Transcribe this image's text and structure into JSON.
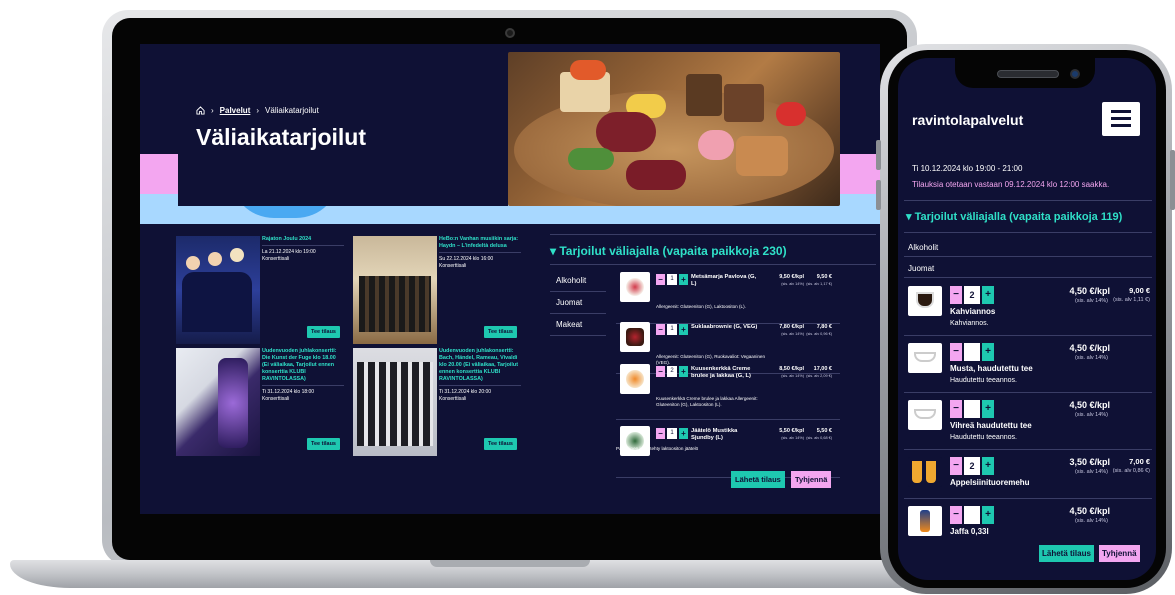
{
  "laptop": {
    "breadcrumb": {
      "home_icon": "home-icon",
      "sep": "›",
      "link": "Palvelut",
      "current": "Väliaikatarjoilut"
    },
    "page_title": "Väliaikatarjoilut",
    "events": [
      {
        "title": "Rajaton Joulu 2024",
        "date": "La 21.12.2024 klo 19:00",
        "venue": "Konserttisali",
        "button": "Tee tilaus"
      },
      {
        "title": "HeBo:n Vanhan musiikin sarja: Haydn – L'infedeltà delusa",
        "date": "Su 22.12.2024 klo 16:00",
        "venue": "Konserttisali",
        "button": "Tee tilaus"
      },
      {
        "title": "Uudenvuoden juhlakonsertti: Die Kunst der Fuge klo 18.00 (Ei väliaikaa, Tarjoilut ennen konserttia KLUBI RAVINTOLASSA)",
        "date": "Ti 31.12.2024 klo 18:00",
        "venue": "Konserttisali",
        "button": "Tee tilaus"
      },
      {
        "title": "Uudenvuoden juhlakonsertti: Bach, Händel, Rameau, Vivaldi klo 20.00 (Ei väliaikaa, Tarjoilut ennen konserttia KLUBI RAVINTOLASSA)",
        "date": "Ti 31.12.2024 klo 20:00",
        "venue": "Konserttisali",
        "button": "Tee tilaus"
      }
    ],
    "offer_title": "Tarjoilut väliajalla (vapaita paikkoja 230)",
    "categories": [
      "Alkoholit",
      "Juomat",
      "Makeat"
    ],
    "products": [
      {
        "qty": "1",
        "name": "Metsämarja Pavlova (G, L)",
        "price": "9,50 €/kpl",
        "vat": "(sis. alv 14%)",
        "total": "9,50 €",
        "total_vat": "(sis. alv 1,17 €)",
        "desc": "Allergeenit: Gluteeniton (G), Laktoositon (L)."
      },
      {
        "qty": "1",
        "name": "Suklaabrownie (G, VEG)",
        "price": "7,80 €/kpl",
        "vat": "(sis. alv 14%)",
        "total": "7,80 €",
        "total_vat": "(sis. alv 0,96 €)",
        "desc": "Allergeenit: Gluteeniton (G), Ruokavaliot: Vegaaninen (VEG)."
      },
      {
        "qty": "2",
        "name": "Kuusenkerkkä Creme brulee ja lakkaa (G, L)",
        "price": "8,50 €/kpl",
        "vat": "(sis. alv 14%)",
        "total": "17,00 €",
        "total_vat": "(sis. alv 2,09 €)",
        "desc": "Kuusenkerkkä Creme brulee ja lakkaa Allergeenit: Gluteeniton (G), Laktoositon (L)."
      },
      {
        "qty": "1",
        "name": "Jäätelö Mustikka Sjundby (L)",
        "price": "5,50 €/kpl",
        "vat": "(sis. alv 14%)",
        "total": "5,50 €",
        "total_vat": "(sis. alv 0,68 €)",
        "desc": "Paikallinen käsintehty laktoositon jäätelö"
      }
    ],
    "send_label": "Lähetä tilaus",
    "clear_label": "Tyhjennä"
  },
  "phone": {
    "brand": "ravintolapalvelut",
    "menu_icon": "hamburger-menu-icon",
    "date": "Ti 10.12.2024 klo 19:00 - 21:00",
    "notice": "Tilauksia otetaan vastaan 09.12.2024 klo 12:00 saakka.",
    "offer_title": "Tarjoilut väliajalla (vapaita paikkoja 119)",
    "categories": [
      "Alkoholit",
      "Juomat"
    ],
    "products": [
      {
        "qty": "2",
        "name": "Kahviannos",
        "desc": "Kahviannos.",
        "price": "4,50 €/kpl",
        "vat": "(sis. alv 14%)",
        "total": "9,00 €",
        "total_vat": "(sis. alv 1,11 €)"
      },
      {
        "qty": "",
        "name": "Musta, haudutettu tee",
        "desc": "Haudutettu teeannos.",
        "price": "4,50 €/kpl",
        "vat": "(sis. alv 14%)",
        "total": "",
        "total_vat": ""
      },
      {
        "qty": "",
        "name": "Vihreä haudutettu tee",
        "desc": "Haudutettu teeannos.",
        "price": "4,50 €/kpl",
        "vat": "(sis. alv 14%)",
        "total": "",
        "total_vat": ""
      },
      {
        "qty": "2",
        "name": "Appelsiinituoremehu",
        "desc": "",
        "price": "3,50 €/kpl",
        "vat": "(sis. alv 14%)",
        "total": "7,00 €",
        "total_vat": "(sis. alv 0,86 €)"
      },
      {
        "qty": "",
        "name": "Jaffa 0,33l",
        "desc": "",
        "price": "4,50 €/kpl",
        "vat": "(sis. alv 14%)",
        "total": "",
        "total_vat": ""
      }
    ],
    "send_label": "Lähetä tilaus",
    "clear_label": "Tyhjennä"
  },
  "colors": {
    "navy": "#0f1135",
    "teal": "#1ec8b0",
    "pink": "#f3a6f0",
    "light_blue": "#a8d8ff"
  }
}
